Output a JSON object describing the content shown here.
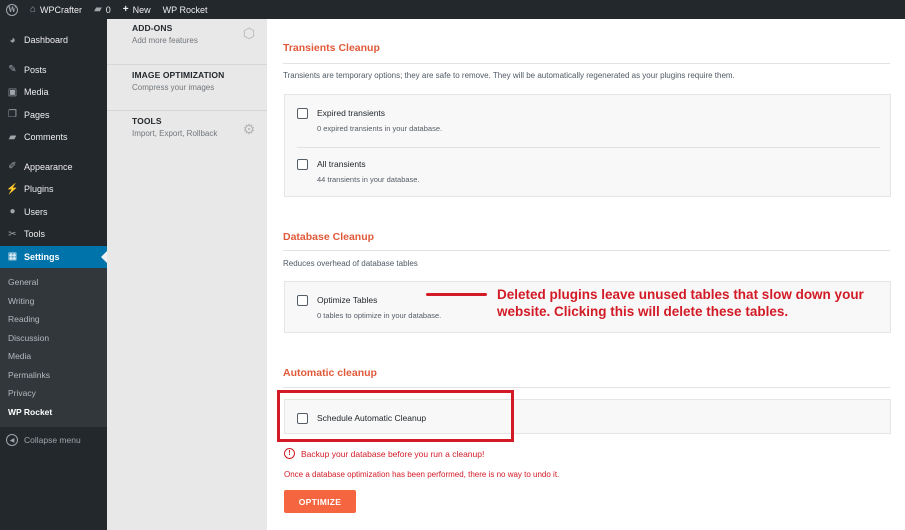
{
  "admin_bar": {
    "site_name": "WPCrafter",
    "comments_count": "0",
    "new_label": "New",
    "plugin_label": "WP Rocket"
  },
  "admin_menu": {
    "items": [
      {
        "label": "Dashboard",
        "icon": "dashboard-icon"
      },
      {
        "label": "Posts",
        "icon": "pin-icon"
      },
      {
        "label": "Media",
        "icon": "media-icon"
      },
      {
        "label": "Pages",
        "icon": "pages-icon"
      },
      {
        "label": "Comments",
        "icon": "comment-icon"
      },
      {
        "label": "Appearance",
        "icon": "brush-icon"
      },
      {
        "label": "Plugins",
        "icon": "plugin-icon"
      },
      {
        "label": "Users",
        "icon": "user-icon"
      },
      {
        "label": "Tools",
        "icon": "wrench-icon"
      },
      {
        "label": "Settings",
        "icon": "settings-icon"
      }
    ],
    "settings_submenu": [
      "General",
      "Writing",
      "Reading",
      "Discussion",
      "Media",
      "Permalinks",
      "Privacy",
      "WP Rocket"
    ],
    "collapse_label": "Collapse menu"
  },
  "rocket_nav": [
    {
      "title": "ADD-ONS",
      "desc": "Add more features",
      "icon": "cubes-icon"
    },
    {
      "title": "IMAGE OPTIMIZATION",
      "desc": "Compress your images",
      "icon": ""
    },
    {
      "title": "TOOLS",
      "desc": "Import, Export, Rollback",
      "icon": "tools-icon"
    }
  ],
  "transients": {
    "title": "Transients Cleanup",
    "desc": "Transients are temporary options; they are safe to remove. They will be automatically regenerated as your plugins require them.",
    "options": [
      {
        "label": "Expired transients",
        "sub": "0 expired transients in your database.",
        "checked": false
      },
      {
        "label": "All transients",
        "sub": "44 transients in your database.",
        "checked": false
      }
    ]
  },
  "database": {
    "title": "Database Cleanup",
    "desc": "Reduces overhead of database tables",
    "options": [
      {
        "label": "Optimize Tables",
        "sub": "0 tables to optimize in your database.",
        "checked": false
      }
    ]
  },
  "annotation": {
    "text": "Deleted plugins leave unused tables that slow down your website. Clicking this will delete these tables.",
    "color": "#d21b26"
  },
  "automatic": {
    "title": "Automatic cleanup",
    "options": [
      {
        "label": "Schedule Automatic Cleanup",
        "checked": false
      }
    ],
    "warning": "Backup your database before you run a cleanup!",
    "note": "Once a database optimization has been performed, there is no way to undo it.",
    "button_label": "OPTIMIZE"
  },
  "colors": {
    "accent": "#e05a3a",
    "button": "#f56640",
    "admin_bg": "#23282d",
    "current_menu": "#0073aa"
  }
}
